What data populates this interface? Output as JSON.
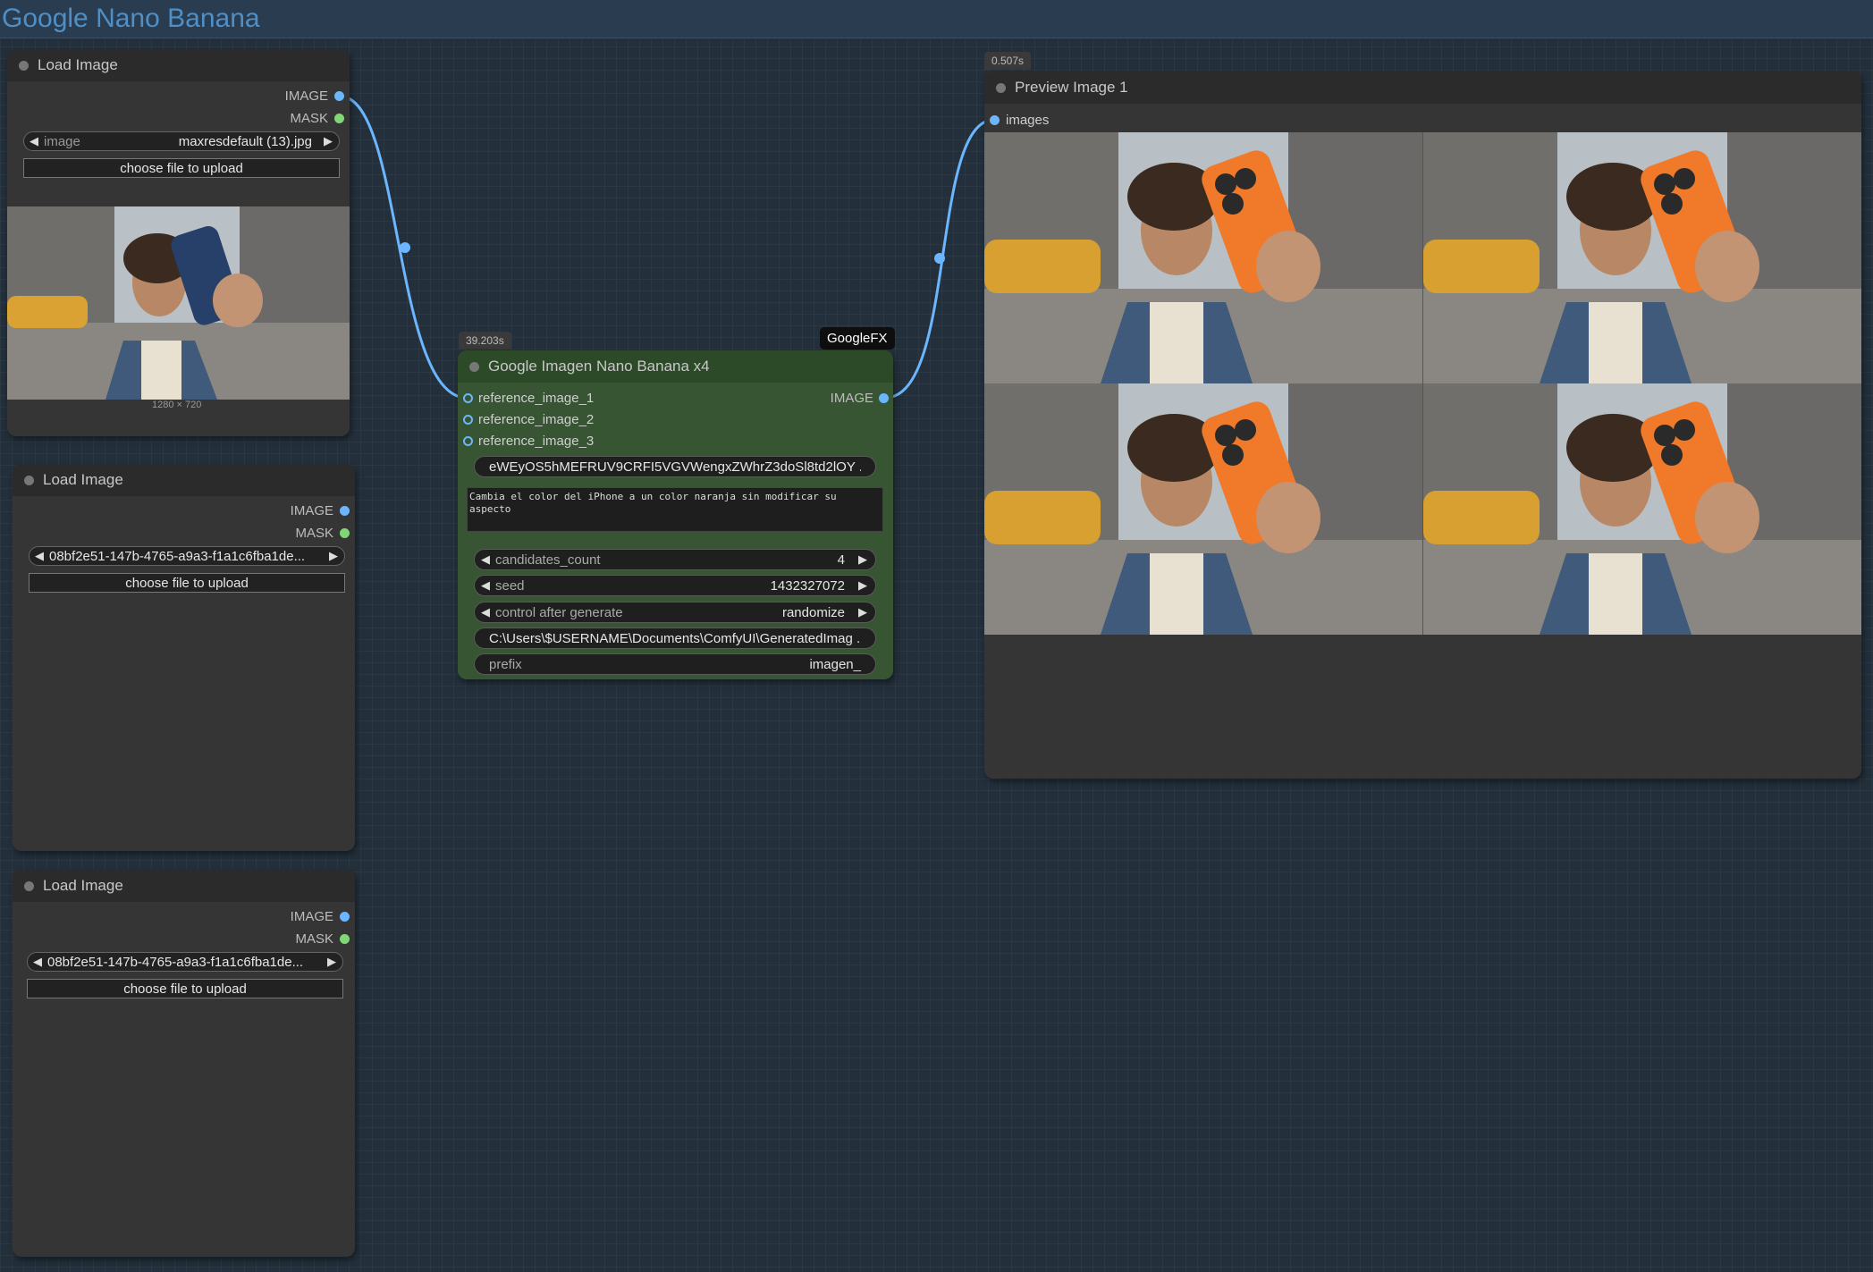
{
  "workflow": {
    "title": "Google Nano Banana"
  },
  "load_image_1": {
    "title": "Load Image",
    "outputs": {
      "image": "IMAGE",
      "mask": "MASK"
    },
    "image_combo": {
      "label": "image",
      "value": "maxresdefault (13).jpg"
    },
    "upload_button": "choose file to upload",
    "dimensions": "1280 × 720"
  },
  "load_image_2": {
    "title": "Load Image",
    "outputs": {
      "image": "IMAGE",
      "mask": "MASK"
    },
    "image_combo": {
      "value": "08bf2e51-147b-4765-a9a3-f1a1c6fba1de..."
    },
    "upload_button": "choose file to upload"
  },
  "load_image_3": {
    "title": "Load Image",
    "outputs": {
      "image": "IMAGE",
      "mask": "MASK"
    },
    "image_combo": {
      "value": "08bf2e51-147b-4765-a9a3-f1a1c6fba1de..."
    },
    "upload_button": "choose file to upload"
  },
  "nano_node": {
    "exec_time": "39.203s",
    "badge": "GoogleFX",
    "title": "Google Imagen Nano Banana x4",
    "inputs": [
      "reference_image_1",
      "reference_image_2",
      "reference_image_3"
    ],
    "output": "IMAGE",
    "api_key": "eWEyOS5hMEFRUV9CRFI5VGVWengxZWhrZ3doSl8td2lOY ...",
    "prompt": "Cambia el color del iPhone a un color naranja sin modificar su aspecto",
    "candidates_count": {
      "label": "candidates_count",
      "value": "4"
    },
    "seed": {
      "label": "seed",
      "value": "1432327072"
    },
    "control_after_generate": {
      "label": "control after generate",
      "value": "randomize"
    },
    "output_path": "C:\\Users\\$USERNAME\\Documents\\ComfyUI\\GeneratedImag ...",
    "prefix": {
      "label": "prefix",
      "value": "imagen_"
    }
  },
  "preview_node": {
    "exec_time": "0.507s",
    "title": "Preview Image 1",
    "input": "images"
  },
  "colors": {
    "canvas": "#23303c",
    "node_bg": "#353535",
    "green_node": "#375532",
    "image_link": "#6bb6ff",
    "mask_socket": "#81d67a",
    "phone_orange": "#f07a2a",
    "phone_blue": "#27406a"
  },
  "icons": [
    "left-arrow-icon",
    "right-arrow-icon",
    "status-dot-icon",
    "socket-icon"
  ]
}
